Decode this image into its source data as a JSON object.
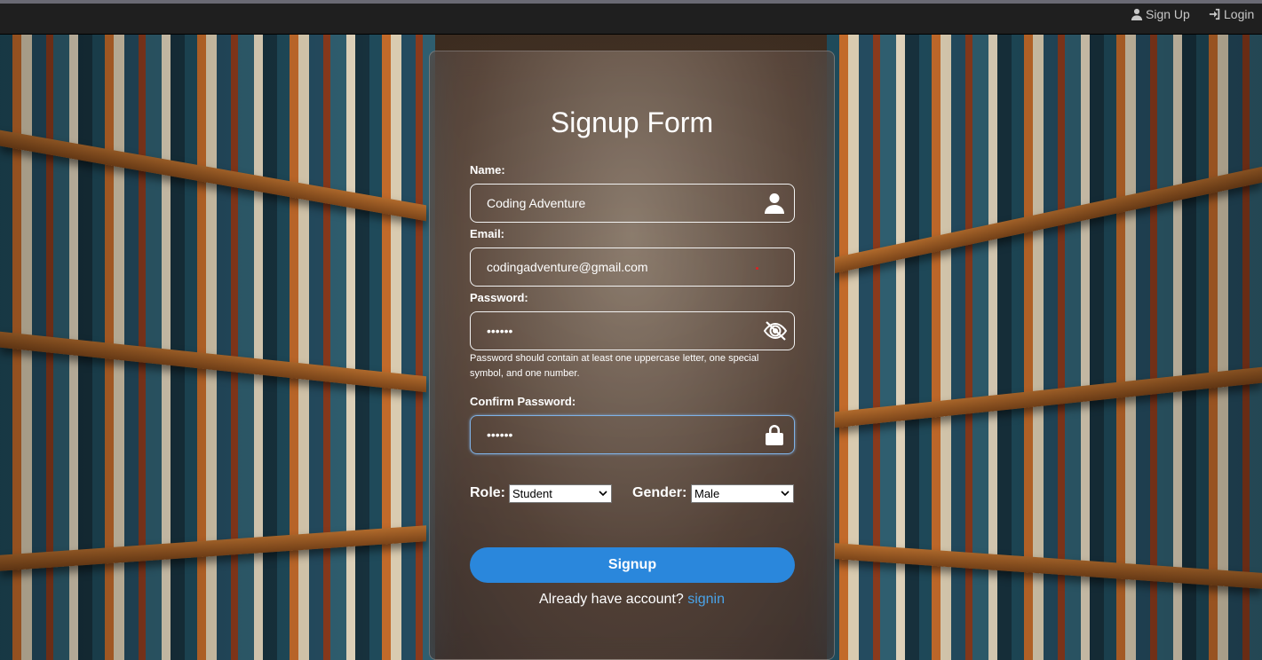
{
  "nav": {
    "signup_label": "Sign Up",
    "login_label": "Login"
  },
  "form": {
    "title": "Signup Form",
    "name_label": "Name:",
    "name_value": "Coding Adventure",
    "email_label": "Email:",
    "email_value": "codingadventure@gmail.com",
    "password_label": "Password:",
    "password_value": "••••••",
    "password_hint": "Password should contain at least one uppercase letter, one special symbol, and one number.",
    "confirm_label": "Confirm Password:",
    "confirm_value": "••••••",
    "role_label": "Role:",
    "role_value": "Student",
    "gender_label": "Gender:",
    "gender_value": "Male",
    "submit_label": "Signup",
    "footer_text": "Already have account?",
    "footer_link": "signin"
  },
  "icons": {
    "name_field": "user-icon",
    "password_field": "eye-slash-icon",
    "confirm_field": "lock-icon",
    "nav_signup": "user-icon",
    "nav_login": "sign-in-icon"
  },
  "colors": {
    "accent": "#2a87dc",
    "link": "#4aa3e8",
    "topbar": "#1f1f1f"
  }
}
